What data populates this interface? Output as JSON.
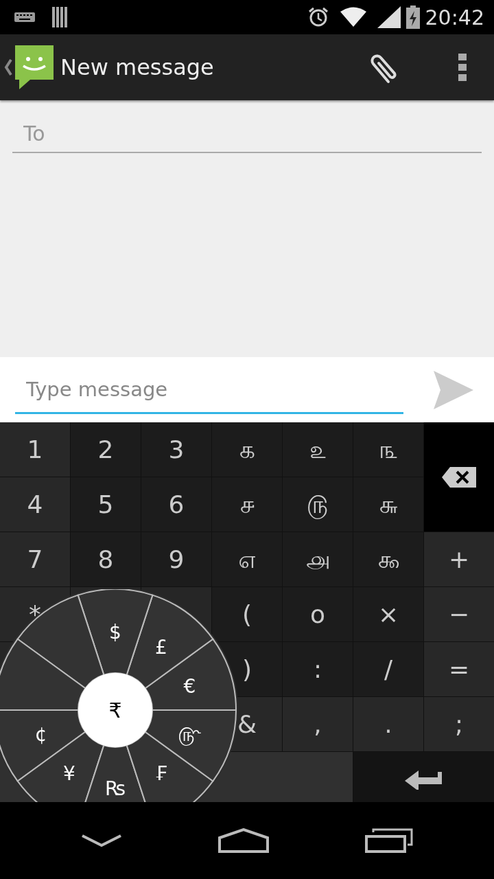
{
  "status_bar": {
    "time": "20:42"
  },
  "action_bar": {
    "title": "New message"
  },
  "recipient": {
    "placeholder": "To"
  },
  "compose": {
    "placeholder": "Type message"
  },
  "keyboard": {
    "rows": [
      [
        {
          "kind": "side",
          "label": "1"
        },
        {
          "kind": "main",
          "label": "2"
        },
        {
          "kind": "main",
          "label": "3"
        },
        {
          "kind": "main",
          "label": "௧"
        },
        {
          "kind": "main",
          "label": "௨"
        },
        {
          "kind": "main",
          "label": "௩"
        },
        {
          "kind": "delete"
        }
      ],
      [
        {
          "kind": "side",
          "label": "4"
        },
        {
          "kind": "main",
          "label": "5"
        },
        {
          "kind": "main",
          "label": "6"
        },
        {
          "kind": "main",
          "label": "௪"
        },
        {
          "kind": "main",
          "label": "௫"
        },
        {
          "kind": "main",
          "label": "௬"
        }
      ],
      [
        {
          "kind": "side",
          "label": "7"
        },
        {
          "kind": "main",
          "label": "8"
        },
        {
          "kind": "main",
          "label": "9"
        },
        {
          "kind": "main",
          "label": "௭"
        },
        {
          "kind": "main",
          "label": "௮"
        },
        {
          "kind": "main",
          "label": "௯"
        },
        {
          "kind": "side",
          "label": "+"
        }
      ],
      [
        {
          "kind": "side",
          "label": "*"
        },
        {
          "kind": "covered"
        },
        {
          "kind": "covered"
        },
        {
          "kind": "main",
          "label": "("
        },
        {
          "kind": "main",
          "label": "o"
        },
        {
          "kind": "main",
          "label": "×"
        },
        {
          "kind": "side",
          "label": "−"
        }
      ],
      [
        {
          "kind": "covered_wide"
        },
        {
          "kind": "main",
          "label": ")"
        },
        {
          "kind": "main",
          "label": ":"
        },
        {
          "kind": "main",
          "label": "/"
        },
        {
          "kind": "side",
          "label": "="
        }
      ],
      [
        {
          "kind": "covered_wide"
        },
        {
          "kind": "side",
          "label": "&"
        },
        {
          "kind": "side",
          "label": ","
        },
        {
          "kind": "side",
          "label": "."
        },
        {
          "kind": "side",
          "label": ";"
        }
      ],
      [
        {
          "kind": "space"
        },
        {
          "kind": "enter"
        }
      ]
    ]
  },
  "currency_wheel": {
    "center": "₹",
    "segments": [
      {
        "kind": "currency",
        "label": "€"
      },
      {
        "kind": "currency",
        "label": "£"
      },
      {
        "kind": "currency",
        "label": "$"
      },
      {
        "kind": "blank"
      },
      {
        "kind": "blank"
      },
      {
        "kind": "currency",
        "label": "¢"
      },
      {
        "kind": "currency",
        "label": "¥"
      },
      {
        "kind": "currency",
        "label": "₨"
      },
      {
        "kind": "currency",
        "label": "₣"
      },
      {
        "kind": "currency",
        "label": "௹"
      }
    ]
  }
}
